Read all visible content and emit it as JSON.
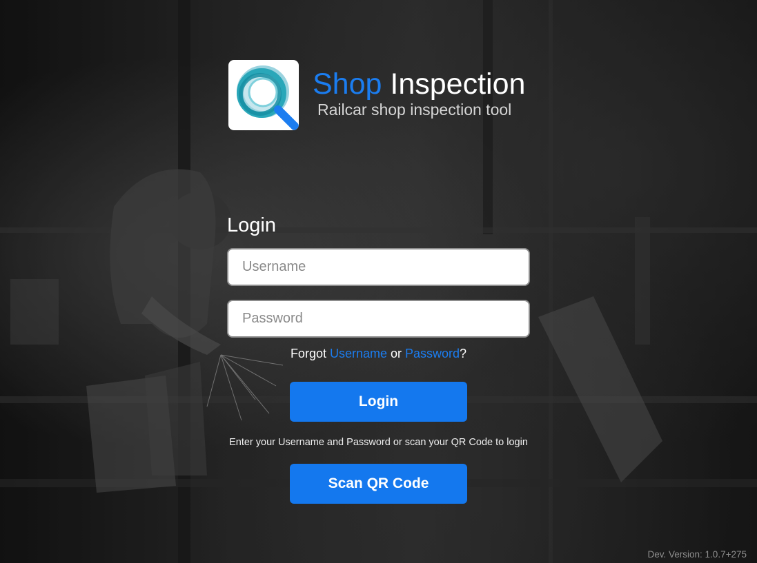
{
  "app": {
    "brand_first": "Shop",
    "brand_second": "Inspection",
    "tagline": "Railcar shop inspection tool",
    "logo_icon": "magnifier-q-icon",
    "brand_color": "#1b7df0"
  },
  "login": {
    "heading": "Login",
    "username_placeholder": "Username",
    "password_placeholder": "Password",
    "forgot_prefix": "Forgot ",
    "forgot_username": "Username",
    "forgot_or": " or ",
    "forgot_password": "Password",
    "forgot_suffix": "?",
    "login_label": "Login",
    "hint": "Enter your Username and Password or scan your QR Code to login",
    "scan_label": "Scan QR Code",
    "button_color": "#1478ee"
  },
  "footer": {
    "version": "Dev. Version: 1.0.7+275"
  }
}
